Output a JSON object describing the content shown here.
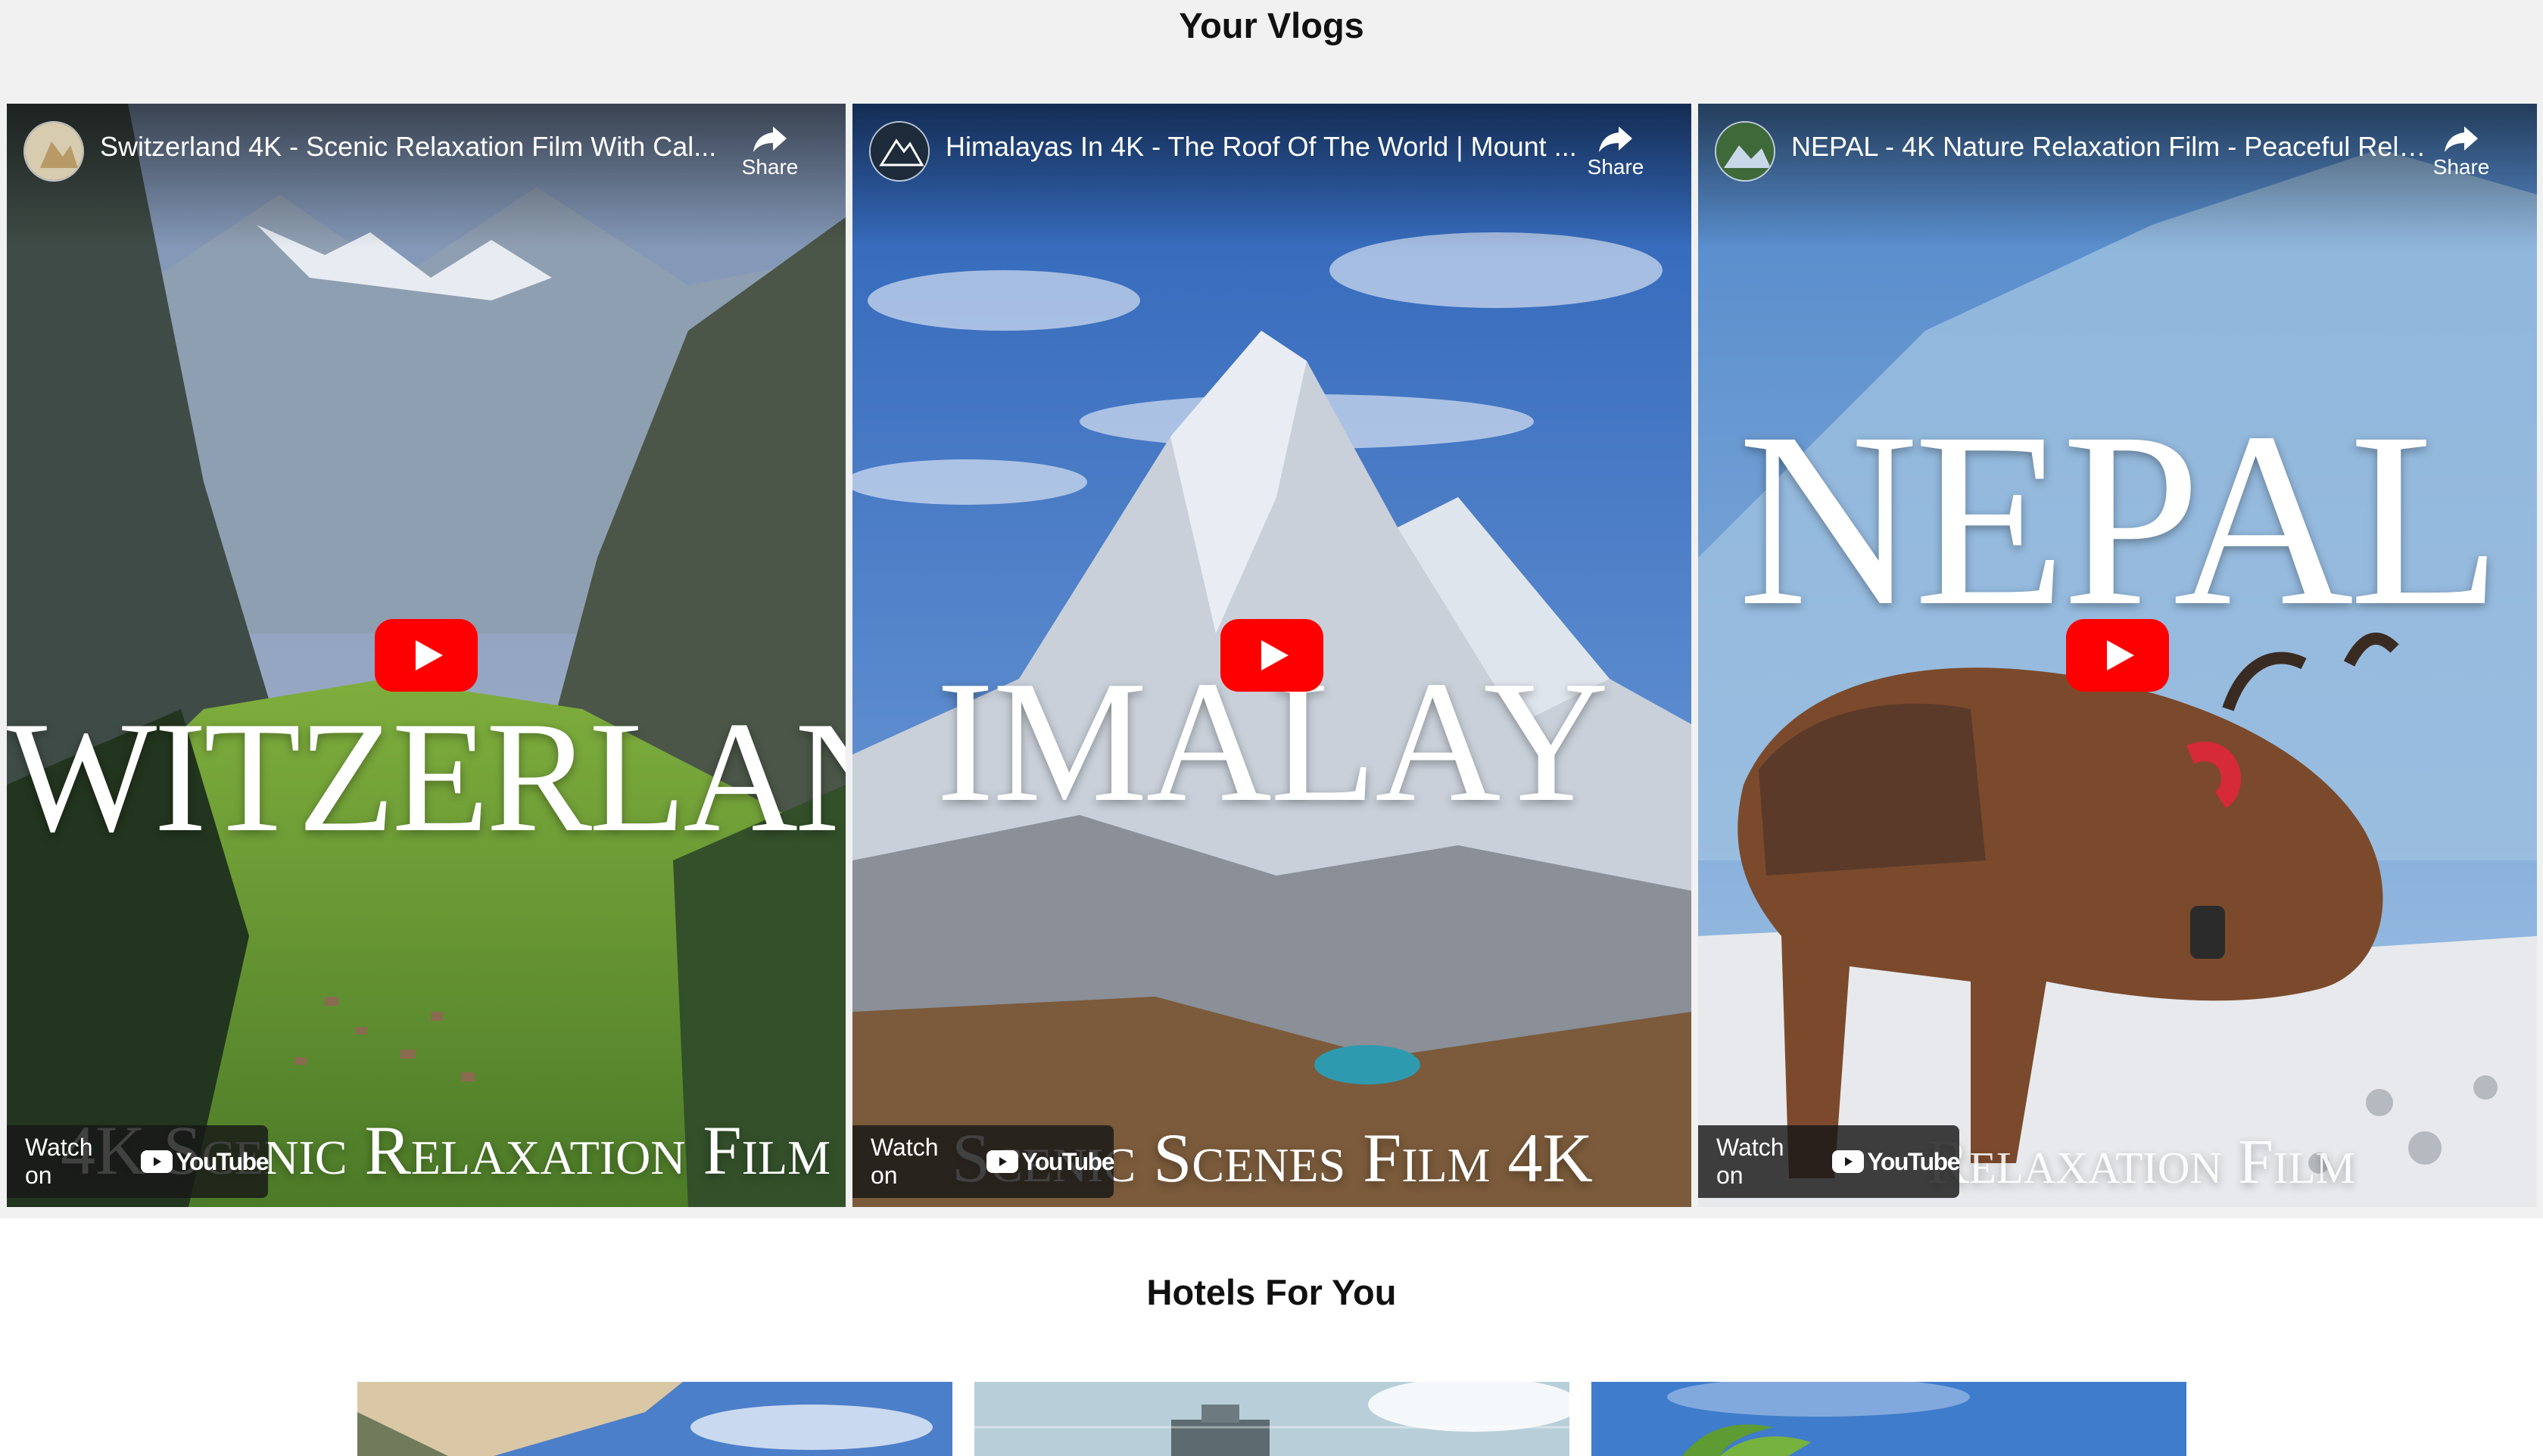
{
  "vlogs": {
    "title": "Your Vlogs",
    "videos": [
      {
        "title": "Switzerland 4K - Scenic Relaxation Film With Cal...",
        "share": "Share",
        "watch_on": "Watch on",
        "platform": "YouTube",
        "big_text": "WITZERLAN",
        "bottom_text": "4K Scenic Relaxation Film"
      },
      {
        "title": "Himalayas In 4K - The Roof Of The World | Mount ...",
        "share": "Share",
        "watch_on": "Watch on",
        "platform": "YouTube",
        "big_text": "IMALAY",
        "bottom_text": "Scenic Scenes Film 4K"
      },
      {
        "title": "NEPAL - 4K Nature Relaxation Film - Peaceful Rela...",
        "share": "Share",
        "watch_on": "Watch on",
        "platform": "YouTube",
        "big_text": "NEPAL",
        "bottom_text": "Relaxation Film"
      }
    ]
  },
  "hotels": {
    "title": "Hotels For You"
  },
  "colors": {
    "youtube_red": "#ff0000",
    "page_bg": "#f1f1f1"
  },
  "icons": [
    "share-icon",
    "play-icon",
    "youtube-icon"
  ]
}
